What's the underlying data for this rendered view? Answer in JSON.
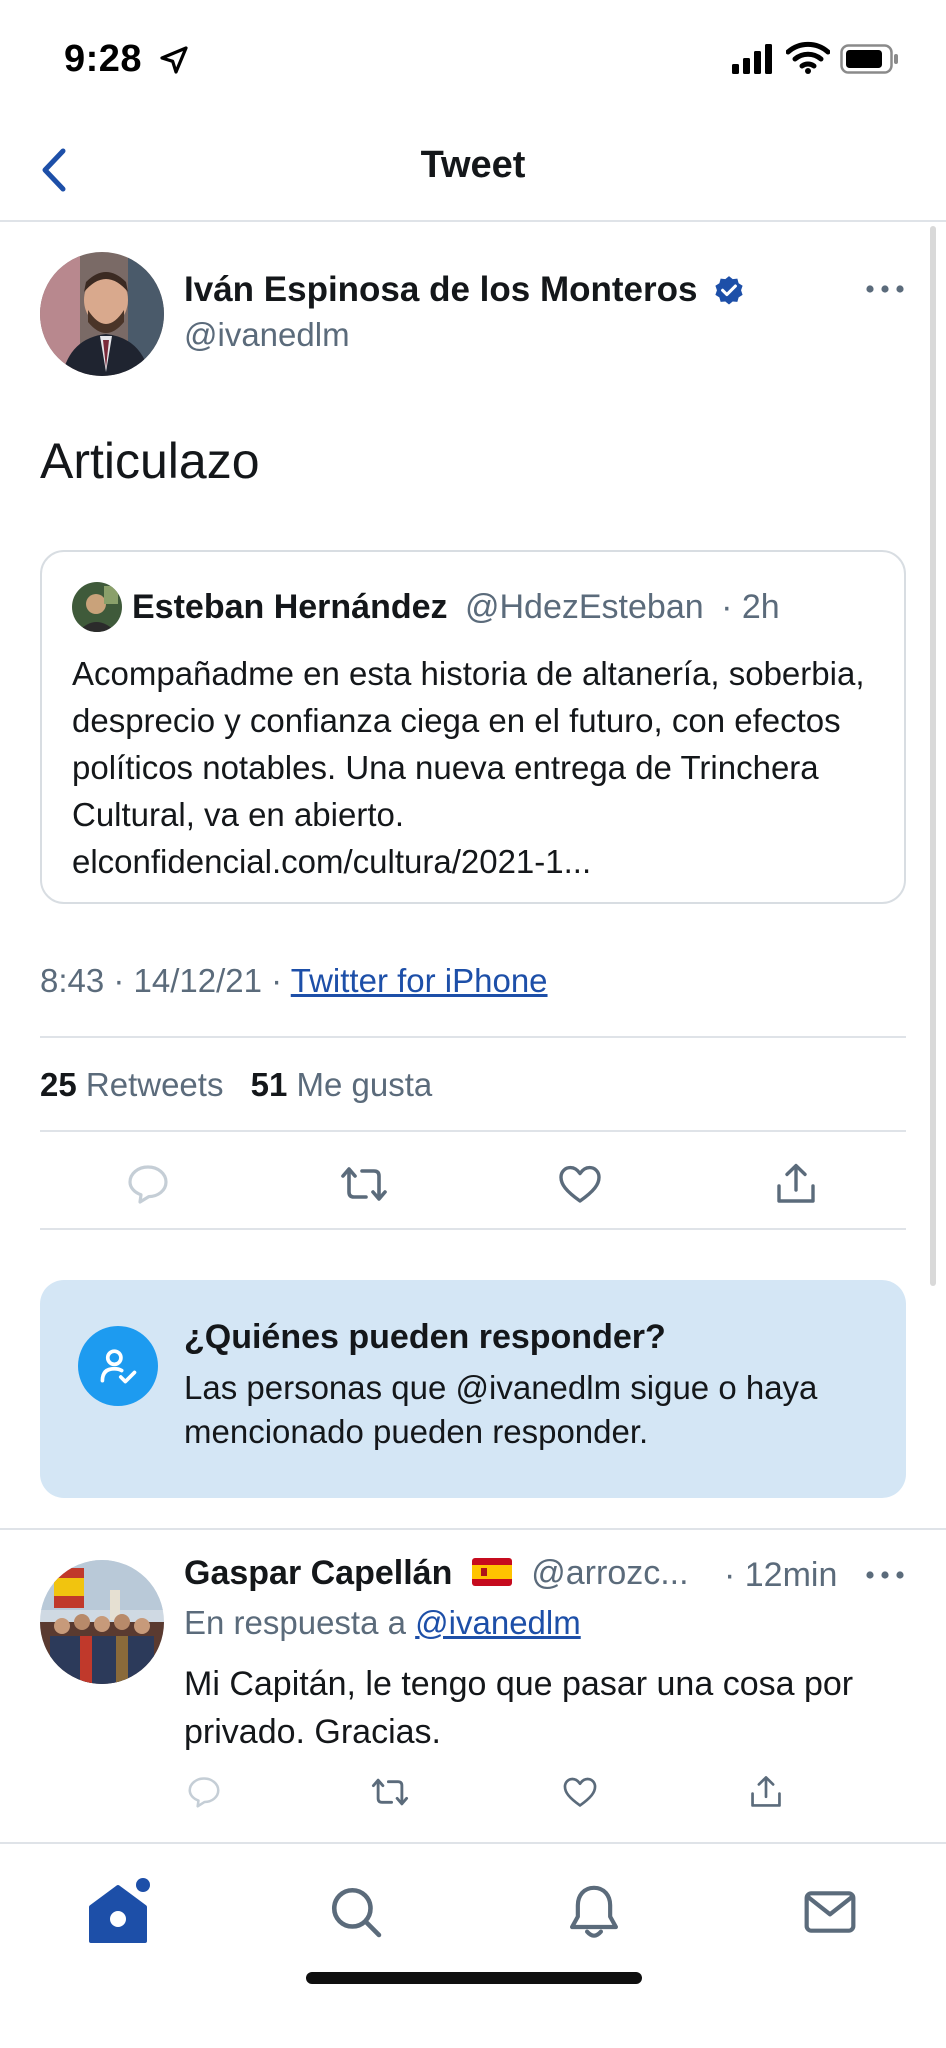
{
  "status_bar": {
    "time": "9:28"
  },
  "nav": {
    "title": "Tweet"
  },
  "tweet": {
    "author_name": "Iván Espinosa de los Monteros",
    "author_handle": "@ivanedlm",
    "text": "Articulazo",
    "quote": {
      "name": "Esteban Hernández",
      "handle": "@HdezEsteban",
      "time": "· 2h",
      "text": "Acompañadme en esta historia de altanería, soberbia, desprecio y confianza ciega en el futuro, con efectos políticos notables. Una nueva entrega de Trinchera Cultural, va en abierto.  elconfidencial.com/cultura/2021-1..."
    },
    "timestamp": "8:43 · 14/12/21 ·",
    "source": "Twitter for iPhone",
    "retweets_count": "25",
    "retweets_label": "Retweets",
    "likes_count": "51",
    "likes_label": "Me gusta"
  },
  "reply_restriction": {
    "title": "¿Quiénes pueden responder?",
    "body": "Las personas que @ivanedlm sigue o haya mencionado pueden responder."
  },
  "reply": {
    "name": "Gaspar Capellán",
    "handle": "@arrozc...",
    "time": "· 12min",
    "in_reply_prefix": "En respuesta a",
    "in_reply_handle": "@ivanedlm",
    "text": "Mi Capitán, le tengo que pasar una cosa por privado. Gracias."
  },
  "icons": {
    "location": "location-arrow-icon",
    "signal": "cellular-signal-icon",
    "wifi": "wifi-icon",
    "battery": "battery-icon",
    "back": "chevron-left-icon",
    "verified": "verified-badge-icon",
    "more": "more-horizontal-icon",
    "reply": "reply-icon",
    "retweet": "retweet-icon",
    "like": "heart-icon",
    "share": "share-icon",
    "restriction": "user-check-icon",
    "home": "home-icon",
    "search": "search-icon",
    "notifications": "bell-icon",
    "messages": "mail-icon"
  },
  "colors": {
    "accent": "#1d9bf0",
    "nav_accent": "#1d4fa8",
    "info_background": "#d4e6f5",
    "secondary_text": "#5b6b7b"
  }
}
